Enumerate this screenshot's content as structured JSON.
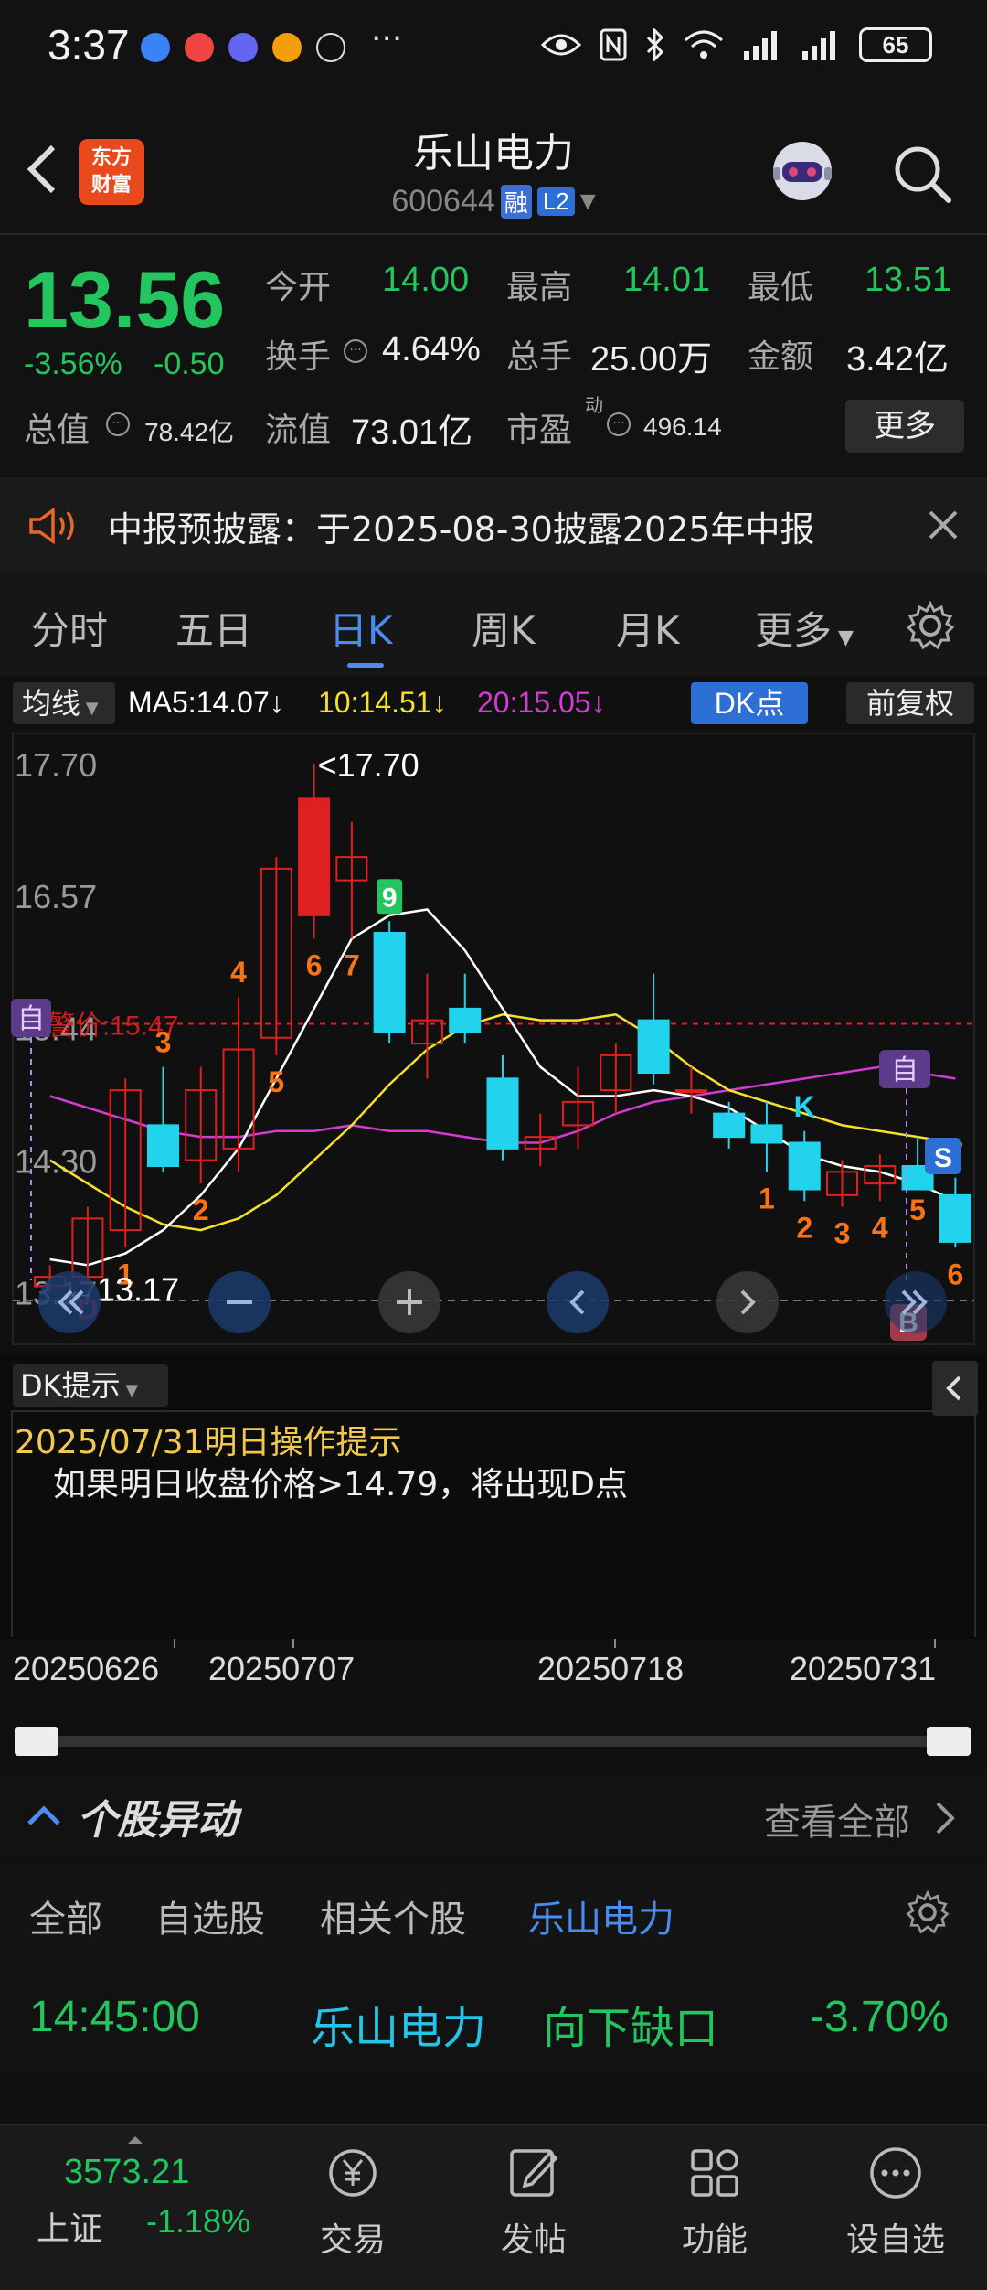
{
  "status": {
    "time": "3:37",
    "dots": "···",
    "battery": "65"
  },
  "header": {
    "logo_line1": "东方",
    "logo_line2": "财富",
    "stock_name": "乐山电力",
    "stock_code": "600644",
    "tag_rong": "融",
    "tag_l2": "L2"
  },
  "quote": {
    "price": "13.56",
    "change_pct": "-3.56%",
    "change": "-0.50",
    "open_label": "今开",
    "open": "14.00",
    "high_label": "最高",
    "high": "14.01",
    "low_label": "最低",
    "low": "13.51",
    "turnover_label": "换手",
    "turnover": "4.64%",
    "volume_label": "总手",
    "volume": "25.00万",
    "amount_label": "金额",
    "amount": "3.42亿",
    "total_cap_label": "总值",
    "total_cap": "78.42亿",
    "float_cap_label": "流值",
    "float_cap": "73.01亿",
    "pe_label": "市盈",
    "pe_sup": "动",
    "pe": "496.14",
    "more": "更多"
  },
  "notice": {
    "text": "中报预披露：于2025-08-30披露2025年中报"
  },
  "tabs": [
    "分时",
    "五日",
    "日K",
    "周K",
    "月K",
    "更多"
  ],
  "active_tab": "日K",
  "chart_head": {
    "ma_button": "均线",
    "ma5": "MA5:14.07",
    "ma10": "10:14.51",
    "ma20": "20:15.05",
    "arrow": "↓",
    "dk_button": "DK点",
    "fq_button": "前复权"
  },
  "colors": {
    "up": "#e02020",
    "down": "#22d3ee",
    "ma5": "#ffffff",
    "ma10": "#f5e12c",
    "ma20": "#d43bd4",
    "accent": "#4a8cf0",
    "price_green": "#22c55e"
  },
  "chart_data": {
    "type": "candlestick",
    "y_ticks": [
      "17.70",
      "16.57",
      "15.44",
      "14.30",
      "13.17"
    ],
    "ylim": [
      13.05,
      17.85
    ],
    "max_label": "17.70",
    "min_label": "13.17",
    "warning_line": {
      "label": "预警价:15.47",
      "value": 15.47
    },
    "prev_close": 13.3,
    "candles": [
      {
        "date": "20250626",
        "open": 13.22,
        "high": 13.4,
        "low": 13.17,
        "close": 13.3
      },
      {
        "date": "20250627",
        "open": 13.3,
        "high": 13.9,
        "low": 13.25,
        "close": 13.8
      },
      {
        "date": "20250630",
        "open": 13.7,
        "high": 15.0,
        "low": 13.55,
        "close": 14.9
      },
      {
        "date": "20250701",
        "open": 14.6,
        "high": 15.1,
        "low": 14.2,
        "close": 14.25
      },
      {
        "date": "20250702",
        "open": 14.3,
        "high": 15.1,
        "low": 14.1,
        "close": 14.9
      },
      {
        "date": "20250703",
        "open": 14.4,
        "high": 15.7,
        "low": 14.2,
        "close": 15.25
      },
      {
        "date": "20250704",
        "open": 15.35,
        "high": 16.9,
        "low": 15.2,
        "close": 16.8
      },
      {
        "date": "20250707",
        "open": 16.4,
        "high": 17.7,
        "low": 16.2,
        "close": 17.4
      },
      {
        "date": "20250708",
        "open": 16.7,
        "high": 17.2,
        "low": 16.2,
        "close": 16.9
      },
      {
        "date": "20250709",
        "open": 16.25,
        "high": 16.35,
        "low": 15.3,
        "close": 15.4
      },
      {
        "date": "20250710",
        "open": 15.3,
        "high": 15.9,
        "low": 15.0,
        "close": 15.5
      },
      {
        "date": "20250711",
        "open": 15.6,
        "high": 15.9,
        "low": 15.3,
        "close": 15.4
      },
      {
        "date": "20250714",
        "open": 15.0,
        "high": 15.2,
        "low": 14.3,
        "close": 14.4
      },
      {
        "date": "20250715",
        "open": 14.4,
        "high": 14.7,
        "low": 14.25,
        "close": 14.5
      },
      {
        "date": "20250716",
        "open": 14.6,
        "high": 15.1,
        "low": 14.4,
        "close": 14.8
      },
      {
        "date": "20250717",
        "open": 14.9,
        "high": 15.3,
        "low": 14.7,
        "close": 15.2
      },
      {
        "date": "20250718",
        "open": 15.5,
        "high": 15.9,
        "low": 14.95,
        "close": 15.05
      },
      {
        "date": "20250721",
        "open": 14.9,
        "high": 15.1,
        "low": 14.7,
        "close": 14.9
      },
      {
        "date": "20250722",
        "open": 14.7,
        "high": 14.8,
        "low": 14.4,
        "close": 14.5
      },
      {
        "date": "20250723",
        "open": 14.6,
        "high": 14.8,
        "low": 14.2,
        "close": 14.45
      },
      {
        "date": "20250724",
        "open": 14.45,
        "high": 14.55,
        "low": 13.95,
        "close": 14.05
      },
      {
        "date": "20250725",
        "open": 14.0,
        "high": 14.3,
        "low": 13.9,
        "close": 14.2
      },
      {
        "date": "20250728",
        "open": 14.1,
        "high": 14.35,
        "low": 13.95,
        "close": 14.25
      },
      {
        "date": "20250729",
        "open": 14.25,
        "high": 14.5,
        "low": 14.1,
        "close": 14.05
      },
      {
        "date": "20250730",
        "open": 14.0,
        "high": 14.15,
        "low": 13.55,
        "close": 13.6
      }
    ],
    "ma5": [
      13.45,
      13.4,
      13.5,
      13.7,
      14.0,
      14.4,
      15.0,
      15.6,
      16.2,
      16.4,
      16.45,
      16.1,
      15.6,
      15.1,
      14.85,
      14.85,
      14.9,
      14.85,
      14.75,
      14.55,
      14.35,
      14.25,
      14.2,
      14.1,
      13.95
    ],
    "ma10": [
      14.3,
      14.1,
      13.9,
      13.75,
      13.7,
      13.8,
      14.0,
      14.3,
      14.6,
      14.95,
      15.25,
      15.45,
      15.55,
      15.5,
      15.5,
      15.55,
      15.35,
      15.1,
      14.9,
      14.8,
      14.7,
      14.6,
      14.55,
      14.5,
      14.45
    ],
    "ma20": [
      14.85,
      14.75,
      14.65,
      14.55,
      14.5,
      14.5,
      14.55,
      14.55,
      14.6,
      14.55,
      14.55,
      14.5,
      14.45,
      14.45,
      14.55,
      14.7,
      14.8,
      14.85,
      14.9,
      14.95,
      15.0,
      15.05,
      15.1,
      15.05,
      15.0
    ],
    "markers": [
      {
        "idx": 2,
        "text": "1",
        "pos": "low",
        "color": "#f97316"
      },
      {
        "idx": 3,
        "text": "3",
        "pos": "high",
        "color": "#f97316"
      },
      {
        "idx": 4,
        "text": "2",
        "pos": "low",
        "color": "#f97316"
      },
      {
        "idx": 5,
        "text": "4",
        "pos": "high",
        "color": "#f97316"
      },
      {
        "idx": 6,
        "text": "5",
        "pos": "low",
        "color": "#f97316"
      },
      {
        "idx": 7,
        "text": "6",
        "pos": "low",
        "color": "#f97316"
      },
      {
        "idx": 8,
        "text": "7",
        "pos": "low",
        "color": "#f97316"
      },
      {
        "idx": 9,
        "text": "9",
        "pos": "high",
        "color": "#22c55e",
        "box": true
      },
      {
        "idx": 19,
        "text": "1",
        "pos": "low",
        "color": "#f97316"
      },
      {
        "idx": 20,
        "text": "2",
        "pos": "low",
        "color": "#f97316"
      },
      {
        "idx": 21,
        "text": "3",
        "pos": "low",
        "color": "#f97316"
      },
      {
        "idx": 22,
        "text": "4",
        "pos": "low",
        "color": "#f97316"
      },
      {
        "idx": 23,
        "text": "5",
        "pos": "low",
        "color": "#f97316"
      },
      {
        "idx": 24,
        "text": "6",
        "pos": "low",
        "color": "#f97316"
      },
      {
        "idx": 20,
        "text": "K",
        "pos": "high",
        "color": "#22d3ee"
      },
      {
        "idx": 24,
        "text": "7",
        "pos": "high",
        "color": "#f97316"
      },
      {
        "idx": 1,
        "text": "D",
        "pos": "low",
        "color": "#e02020"
      }
    ],
    "self_label": "自",
    "s_label": "S",
    "b_label": "B"
  },
  "dk_tip": {
    "button": "DK提示",
    "title": "2025/07/31明日操作提示",
    "body": "如果明日收盘价格>14.79，将出现D点"
  },
  "date_axis": [
    "20250626",
    "20250707",
    "20250718",
    "20250731"
  ],
  "moves": {
    "title": "个股异动",
    "view_all": "查看全部",
    "tabs": [
      "全部",
      "自选股",
      "相关个股",
      "乐山电力"
    ],
    "row": {
      "time": "14:45:00",
      "name": "乐山电力",
      "type": "向下缺口",
      "pct": "-3.70%"
    }
  },
  "bottom_nav": {
    "index_value": "3573.21",
    "index_name": "上证",
    "index_change": "-1.18%",
    "items": [
      "交易",
      "发帖",
      "功能",
      "设自选"
    ]
  }
}
